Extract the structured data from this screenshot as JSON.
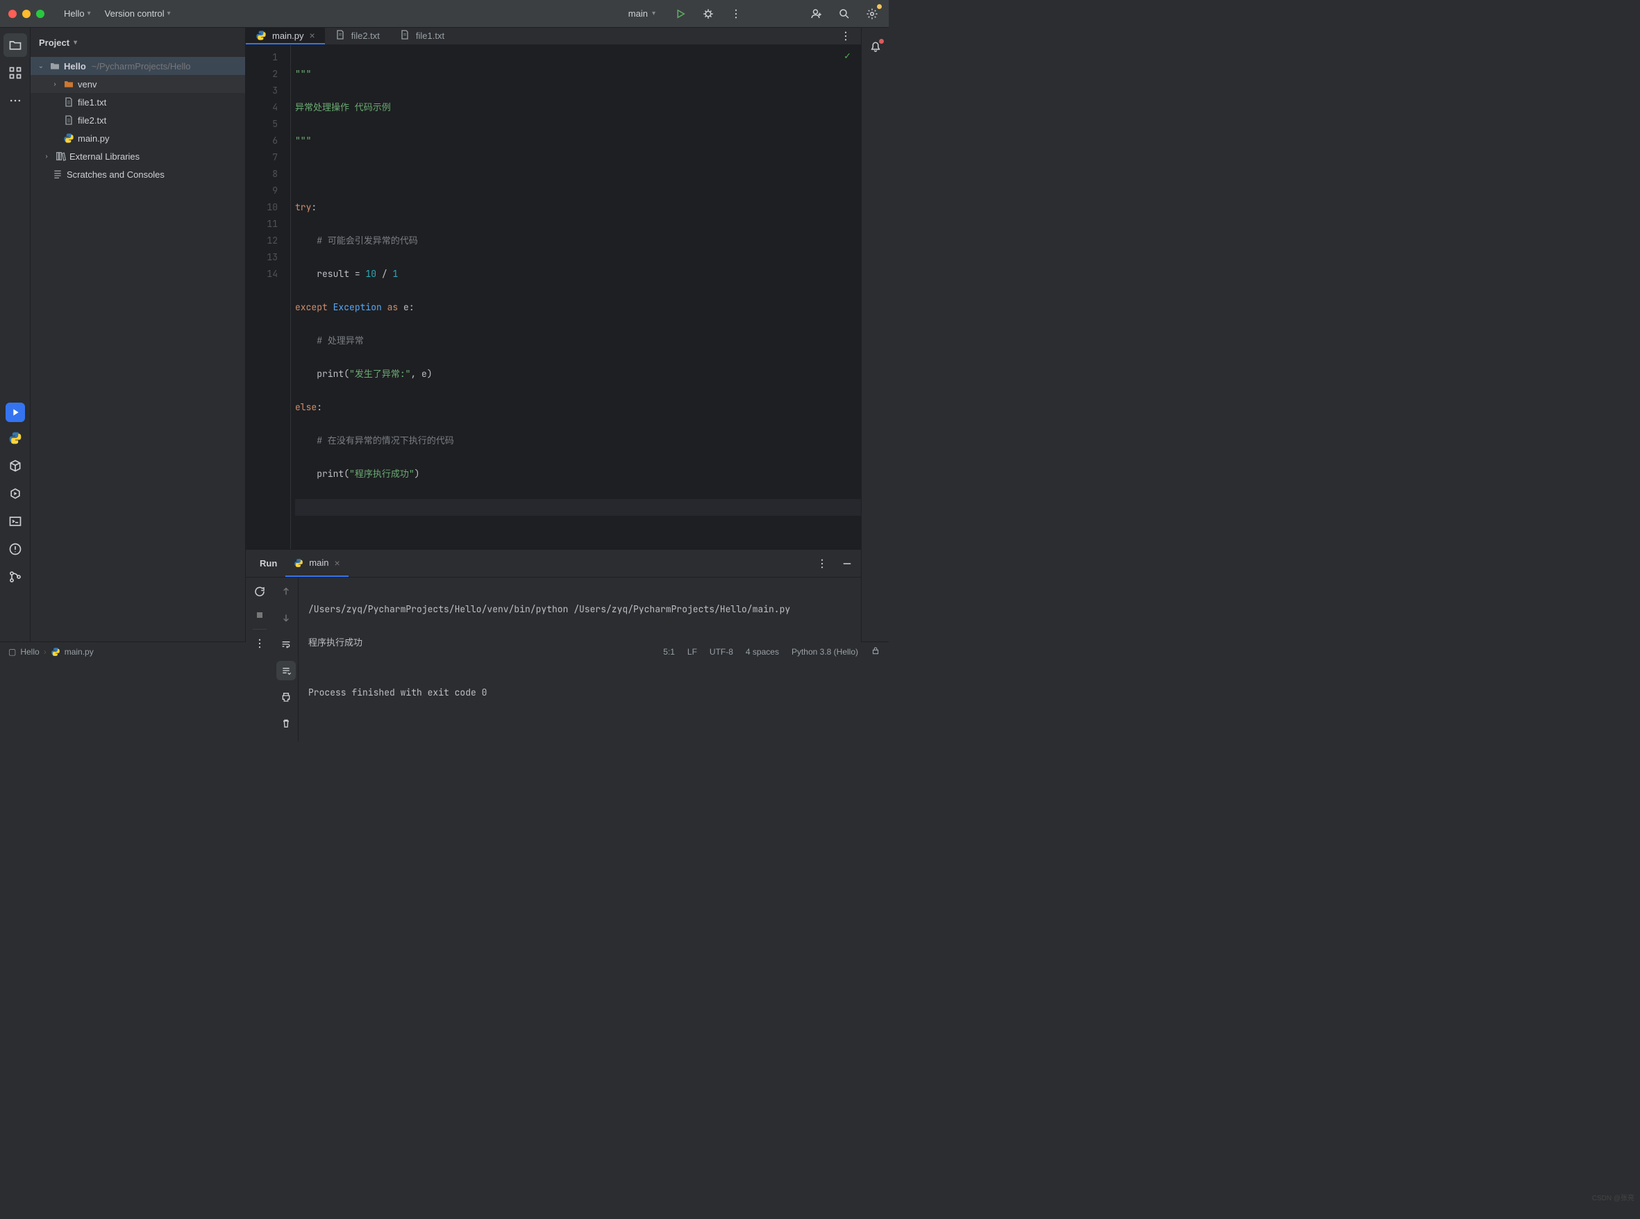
{
  "titlebar": {
    "menu1": "Hello",
    "menu2": "Version control",
    "run_config": "main"
  },
  "project_panel": {
    "title": "Project",
    "root_name": "Hello",
    "root_path": "~/PycharmProjects/Hello",
    "venv": "venv",
    "file1": "file1.txt",
    "file2": "file2.txt",
    "mainpy": "main.py",
    "ext_lib": "External Libraries",
    "scratches": "Scratches and Consoles"
  },
  "tabs": {
    "t0": "main.py",
    "t1": "file2.txt",
    "t2": "file1.txt"
  },
  "editor": {
    "lines": {
      "n1": "1",
      "n2": "2",
      "n3": "3",
      "n4": "4",
      "n5": "5",
      "n6": "6",
      "n7": "7",
      "n8": "8",
      "n9": "9",
      "n10": "10",
      "n11": "11",
      "n12": "12",
      "n13": "13",
      "n14": "14"
    },
    "l1": "\"\"\"",
    "l2": "异常处理操作 代码示例",
    "l3": "\"\"\"",
    "l5_try": "try",
    "l5_colon": ":",
    "l6": "    # 可能会引发异常的代码",
    "l7_a": "    result ",
    "l7_eq": "=",
    "l7_sp": " ",
    "l7_n1": "10",
    "l7_div": " / ",
    "l7_n2": "1",
    "l8_except": "except",
    "l8_sp": " ",
    "l8_exc": "Exception",
    "l8_as": " as ",
    "l8_e": "e:",
    "l9": "    # 处理异常",
    "l10_ind": "    ",
    "l10_print": "print",
    "l10_open": "(",
    "l10_str": "\"发生了异常:\"",
    "l10_rest": ", e)",
    "l11_else": "else",
    "l11_colon": ":",
    "l12": "    # 在没有异常的情况下执行的代码",
    "l13_ind": "    ",
    "l13_print": "print",
    "l13_open": "(",
    "l13_str": "\"程序执行成功\"",
    "l13_close": ")"
  },
  "run_panel": {
    "label": "Run",
    "tab": "main",
    "out1": "/Users/zyq/PycharmProjects/Hello/venv/bin/python /Users/zyq/PycharmProjects/Hello/main.py",
    "out2": "程序执行成功",
    "out3": "",
    "out4": "Process finished with exit code 0"
  },
  "statusbar": {
    "bc1": "Hello",
    "bc2": "main.py",
    "pos": "5:1",
    "le": "LF",
    "enc": "UTF-8",
    "indent": "4 spaces",
    "interp": "Python 3.8 (Hello)"
  },
  "watermark": "CSDN @张亮"
}
